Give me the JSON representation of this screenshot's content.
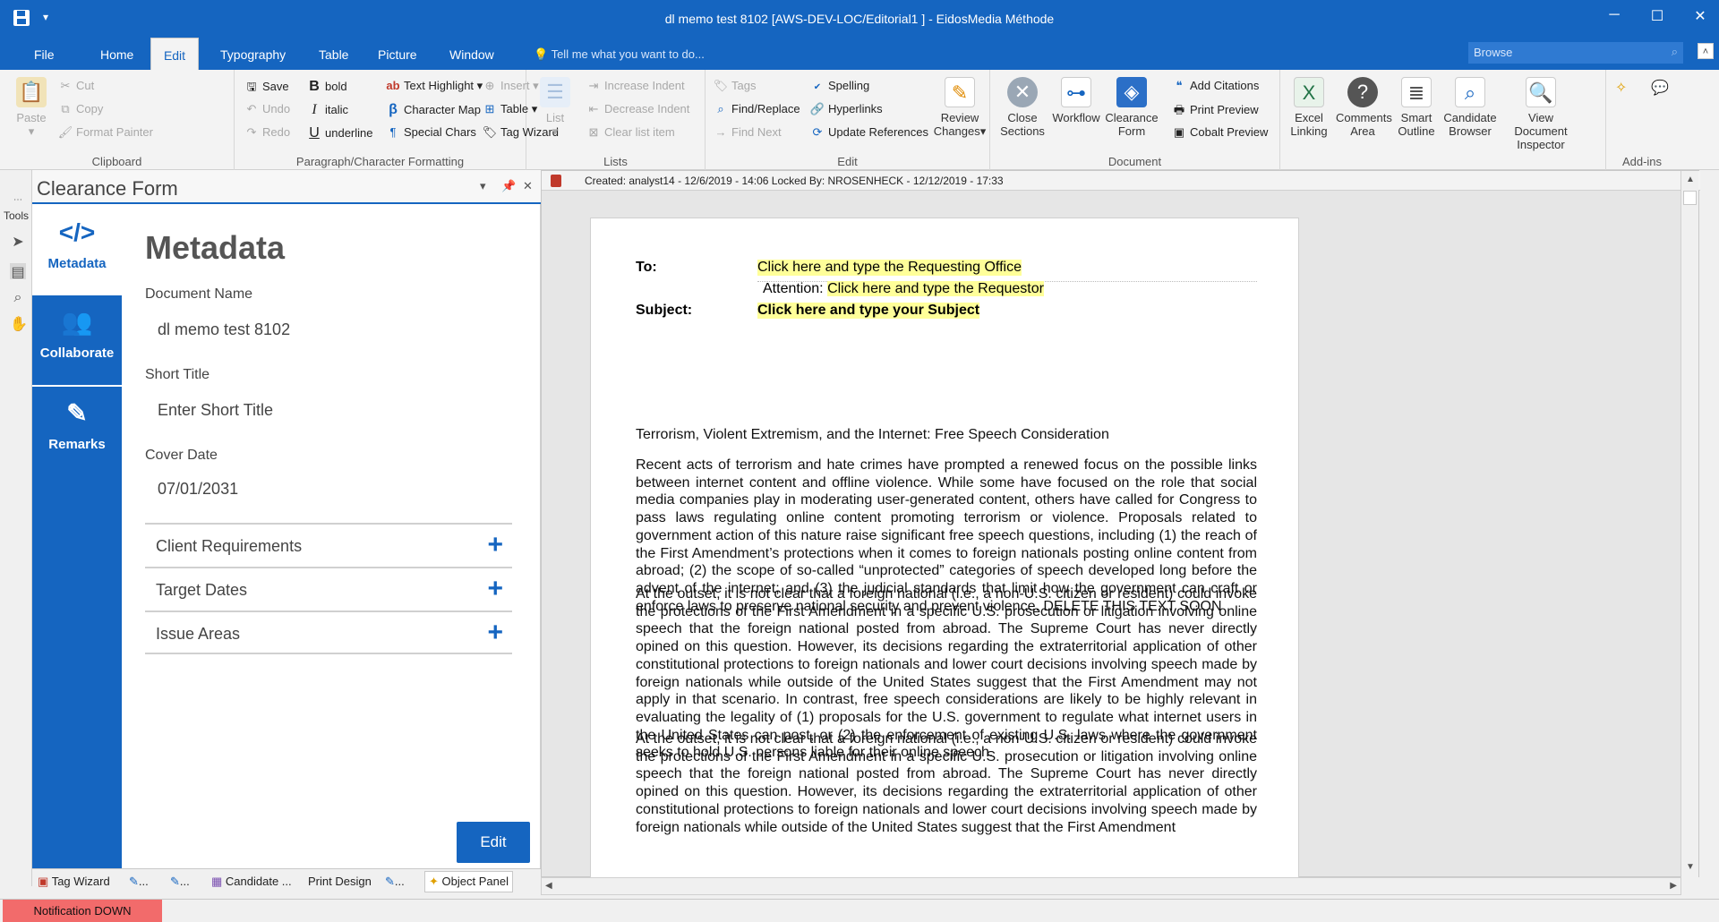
{
  "window": {
    "title": "dl memo test 8102  [AWS-DEV-LOC/Editorial1 ] - EidosMedia Méthode",
    "save_icon": "save-icon",
    "minimize": "─",
    "maximize": "☐",
    "close": "✕"
  },
  "tabs": [
    "File",
    "Home",
    "Edit",
    "Typography",
    "Table",
    "Picture",
    "Window"
  ],
  "active_tab": "Edit",
  "tell_me": "Tell me what you want to do...",
  "browse": "Browse",
  "ribbon": {
    "clipboard": {
      "label": "Clipboard",
      "paste": "Paste",
      "cut": "Cut",
      "copy": "Copy",
      "format_painter": "Format Painter"
    },
    "paragraph": {
      "label": "Paragraph/Character Formatting",
      "save": "Save",
      "undo": "Undo",
      "redo": "Redo",
      "bold": "bold",
      "italic": "italic",
      "underline": "underline",
      "text_highlight": "Text Highlight",
      "character_map": "Character Map",
      "special_chars": "Special Chars",
      "insert": "Insert",
      "table": "Table",
      "tag_wizard": "Tag Wizard"
    },
    "lists": {
      "label": "Lists",
      "list": "List",
      "increase_indent": "Increase Indent",
      "decrease_indent": "Decrease Indent",
      "clear_list_item": "Clear list item"
    },
    "edit": {
      "label": "Edit",
      "tags": "Tags",
      "find_replace": "Find/Replace",
      "find_next": "Find Next",
      "spelling": "Spelling",
      "hyperlinks": "Hyperlinks",
      "update_references": "Update References",
      "review_changes_1": "Review",
      "review_changes_2": "Changes"
    },
    "document": {
      "label": "Document",
      "close_sections_1": "Close",
      "close_sections_2": "Sections",
      "workflow": "Workflow",
      "clearance_form_1": "Clearance",
      "clearance_form_2": "Form",
      "add_citations": "Add Citations",
      "print_preview": "Print Preview",
      "cobalt_preview": "Cobalt Preview"
    },
    "more": {
      "excel_1": "Excel",
      "excel_2": "Linking",
      "comments_1": "Comments",
      "comments_2": "Area",
      "smart_1": "Smart",
      "smart_2": "Outline",
      "candidate_1": "Candidate",
      "candidate_2": "Browser",
      "view_doc_1": "View Document",
      "view_doc_2": "Inspector"
    },
    "addins": {
      "label": "Add-ins"
    }
  },
  "tools_label": "Tools",
  "panel": {
    "title": "Clearance Form",
    "nav": [
      {
        "label": "Metadata",
        "icon": "code-icon"
      },
      {
        "label": "Collaborate",
        "icon": "users-icon"
      },
      {
        "label": "Remarks",
        "icon": "edit-icon"
      }
    ],
    "heading": "Metadata",
    "document_name_label": "Document Name",
    "document_name": "dl memo test 8102",
    "short_title_label": "Short Title",
    "short_title": "Enter Short Title",
    "cover_date_label": "Cover Date",
    "cover_date": "07/01/2031",
    "sections": [
      "Client Requirements",
      "Target Dates",
      "Issue Areas"
    ],
    "edit_button": "Edit"
  },
  "docinfo": "Created: analyst14 - 12/6/2019 - 14:06   Locked By: NROSENHECK - 12/12/2019 - 17:33",
  "document": {
    "to_label": "To:",
    "to_value": "Click here and type the Requesting Office",
    "attention_label": "Attention:",
    "attention_value": "Click here and type the Requestor",
    "subject_label": "Subject:",
    "subject_value": "Click here and type your Subject",
    "heading": "Terrorism, Violent Extremism, and the Internet: Free Speech Consideration",
    "para1": "Recent acts of terrorism and hate crimes have prompted a renewed focus on the possible links between internet content and offline violence. While some have focused on the role that social media companies play in moderating user-generated content, others have called for Congress to pass laws regulating online content promoting terrorism or violence. Proposals related to government action of this nature raise significant free speech questions, including (1) the reach of the First Amendment’s protections when it comes to foreign nationals posting online content from abroad; (2) the scope of so-called “unprotected” categories of speech developed long before the advent of the internet; and (3) the judicial standards that limit how the government can craft or enforce laws to preserve national security and prevent violence. DELETE THIS TEXT SOON",
    "para2": "At the outset, it is not clear that a foreign national (i.e., a non-U.S. citizen or resident) could invoke the protections of the First Amendment in a specific U.S. prosecution or litigation involving online speech that the foreign national posted from abroad. The Supreme Court has never directly opined on this question. However, its decisions regarding the extraterritorial application of other constitutional protections to foreign nationals and lower court decisions involving speech made by foreign nationals while outside of the United States suggest that the First Amendment may not apply in that scenario. In contrast, free speech considerations are likely to be highly relevant in evaluating the legality of (1) proposals for the U.S. government to regulate what internet users in the United States can post, or (2) the enforcement of existing U.S. laws where the government seeks to hold U.S. persons liable for their online speech.",
    "para3": "At the outset, it is not clear that a foreign national (i.e., a non-U.S. citizen or resident) could invoke the protections of the First Amendment in a specific U.S. prosecution or litigation involving online speech that the foreign national posted from abroad. The Supreme Court has never directly opined on this question. However, its decisions regarding the extraterritorial application of other constitutional protections to foreign nationals and lower court decisions involving speech made by foreign nationals while outside of the United States suggest that the First Amendment"
  },
  "taskbar": {
    "tag_wizard": "Tag Wizard",
    "item2": "...",
    "item3": "...",
    "candidate": "Candidate ...",
    "print_design": "Print Design",
    "item6": "...",
    "object_panel": "Object Panel"
  },
  "notification": "Notification DOWN",
  "colors": {
    "accent": "#1565c0",
    "highlight": "#ffff99",
    "notification": "#f26b6b"
  }
}
